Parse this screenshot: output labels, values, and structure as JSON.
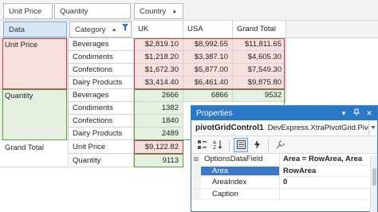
{
  "filter_area": {
    "unit_price": "Unit Price",
    "quantity": "Quantity",
    "country": "Country"
  },
  "row_fields": {
    "data": "Data",
    "category": "Category"
  },
  "column_headers": [
    "UK",
    "USA",
    "Grand Total"
  ],
  "rows": {
    "unit_price_label": "Unit Price",
    "quantity_label": "Quantity",
    "grand_total_label": "Grand Total",
    "categories": [
      "Beverages",
      "Condiments",
      "Confections",
      "Dairy Products"
    ],
    "unit_price_values": [
      [
        "$2,819.10",
        "$8,992.55",
        "$11,811.65"
      ],
      [
        "$1,218.20",
        "$3,387.10",
        "$4,605.30"
      ],
      [
        "$1,672.30",
        "$5,877.00",
        "$7,549.30"
      ],
      [
        "$3,414.40",
        "$6,461.40",
        "$9,875.80"
      ]
    ],
    "quantity_values": [
      [
        "2666",
        "6866",
        "9532"
      ],
      [
        "1382",
        "",
        ""
      ],
      [
        "1840",
        "",
        ""
      ],
      [
        "2489",
        "",
        ""
      ]
    ],
    "grand_total_rows": [
      {
        "label": "Unit Price",
        "uk": "$9,122.82"
      },
      {
        "label": "Quantity",
        "uk": "9113"
      }
    ]
  },
  "properties": {
    "title": "Properties",
    "object_name": "pivotGridControl1",
    "object_type": "DevExpress.XtraPivotGrid.Piv",
    "items": [
      {
        "name": "OptionsDataField",
        "value": "Area = RowArea, Area",
        "expander": "minus"
      },
      {
        "name": "Area",
        "value": "RowArea",
        "selected": true
      },
      {
        "name": "AreaIndex",
        "value": "0"
      },
      {
        "name": "Caption",
        "value": ""
      }
    ]
  },
  "colors": {
    "accent": "#2b78c9",
    "unit_price_area": "#f8e0e0",
    "quantity_area": "#e6f0e0"
  }
}
